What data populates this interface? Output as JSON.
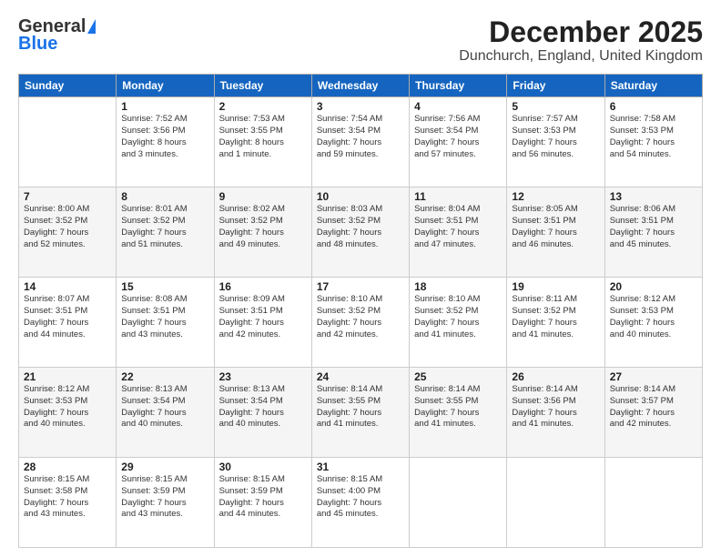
{
  "header": {
    "logo_general": "General",
    "logo_blue": "Blue",
    "month_title": "December 2025",
    "location": "Dunchurch, England, United Kingdom"
  },
  "days_of_week": [
    "Sunday",
    "Monday",
    "Tuesday",
    "Wednesday",
    "Thursday",
    "Friday",
    "Saturday"
  ],
  "weeks": [
    [
      {
        "day": "",
        "info": ""
      },
      {
        "day": "1",
        "info": "Sunrise: 7:52 AM\nSunset: 3:56 PM\nDaylight: 8 hours\nand 3 minutes."
      },
      {
        "day": "2",
        "info": "Sunrise: 7:53 AM\nSunset: 3:55 PM\nDaylight: 8 hours\nand 1 minute."
      },
      {
        "day": "3",
        "info": "Sunrise: 7:54 AM\nSunset: 3:54 PM\nDaylight: 7 hours\nand 59 minutes."
      },
      {
        "day": "4",
        "info": "Sunrise: 7:56 AM\nSunset: 3:54 PM\nDaylight: 7 hours\nand 57 minutes."
      },
      {
        "day": "5",
        "info": "Sunrise: 7:57 AM\nSunset: 3:53 PM\nDaylight: 7 hours\nand 56 minutes."
      },
      {
        "day": "6",
        "info": "Sunrise: 7:58 AM\nSunset: 3:53 PM\nDaylight: 7 hours\nand 54 minutes."
      }
    ],
    [
      {
        "day": "7",
        "info": "Sunrise: 8:00 AM\nSunset: 3:52 PM\nDaylight: 7 hours\nand 52 minutes."
      },
      {
        "day": "8",
        "info": "Sunrise: 8:01 AM\nSunset: 3:52 PM\nDaylight: 7 hours\nand 51 minutes."
      },
      {
        "day": "9",
        "info": "Sunrise: 8:02 AM\nSunset: 3:52 PM\nDaylight: 7 hours\nand 49 minutes."
      },
      {
        "day": "10",
        "info": "Sunrise: 8:03 AM\nSunset: 3:52 PM\nDaylight: 7 hours\nand 48 minutes."
      },
      {
        "day": "11",
        "info": "Sunrise: 8:04 AM\nSunset: 3:51 PM\nDaylight: 7 hours\nand 47 minutes."
      },
      {
        "day": "12",
        "info": "Sunrise: 8:05 AM\nSunset: 3:51 PM\nDaylight: 7 hours\nand 46 minutes."
      },
      {
        "day": "13",
        "info": "Sunrise: 8:06 AM\nSunset: 3:51 PM\nDaylight: 7 hours\nand 45 minutes."
      }
    ],
    [
      {
        "day": "14",
        "info": "Sunrise: 8:07 AM\nSunset: 3:51 PM\nDaylight: 7 hours\nand 44 minutes."
      },
      {
        "day": "15",
        "info": "Sunrise: 8:08 AM\nSunset: 3:51 PM\nDaylight: 7 hours\nand 43 minutes."
      },
      {
        "day": "16",
        "info": "Sunrise: 8:09 AM\nSunset: 3:51 PM\nDaylight: 7 hours\nand 42 minutes."
      },
      {
        "day": "17",
        "info": "Sunrise: 8:10 AM\nSunset: 3:52 PM\nDaylight: 7 hours\nand 42 minutes."
      },
      {
        "day": "18",
        "info": "Sunrise: 8:10 AM\nSunset: 3:52 PM\nDaylight: 7 hours\nand 41 minutes."
      },
      {
        "day": "19",
        "info": "Sunrise: 8:11 AM\nSunset: 3:52 PM\nDaylight: 7 hours\nand 41 minutes."
      },
      {
        "day": "20",
        "info": "Sunrise: 8:12 AM\nSunset: 3:53 PM\nDaylight: 7 hours\nand 40 minutes."
      }
    ],
    [
      {
        "day": "21",
        "info": "Sunrise: 8:12 AM\nSunset: 3:53 PM\nDaylight: 7 hours\nand 40 minutes."
      },
      {
        "day": "22",
        "info": "Sunrise: 8:13 AM\nSunset: 3:54 PM\nDaylight: 7 hours\nand 40 minutes."
      },
      {
        "day": "23",
        "info": "Sunrise: 8:13 AM\nSunset: 3:54 PM\nDaylight: 7 hours\nand 40 minutes."
      },
      {
        "day": "24",
        "info": "Sunrise: 8:14 AM\nSunset: 3:55 PM\nDaylight: 7 hours\nand 41 minutes."
      },
      {
        "day": "25",
        "info": "Sunrise: 8:14 AM\nSunset: 3:55 PM\nDaylight: 7 hours\nand 41 minutes."
      },
      {
        "day": "26",
        "info": "Sunrise: 8:14 AM\nSunset: 3:56 PM\nDaylight: 7 hours\nand 41 minutes."
      },
      {
        "day": "27",
        "info": "Sunrise: 8:14 AM\nSunset: 3:57 PM\nDaylight: 7 hours\nand 42 minutes."
      }
    ],
    [
      {
        "day": "28",
        "info": "Sunrise: 8:15 AM\nSunset: 3:58 PM\nDaylight: 7 hours\nand 43 minutes."
      },
      {
        "day": "29",
        "info": "Sunrise: 8:15 AM\nSunset: 3:59 PM\nDaylight: 7 hours\nand 43 minutes."
      },
      {
        "day": "30",
        "info": "Sunrise: 8:15 AM\nSunset: 3:59 PM\nDaylight: 7 hours\nand 44 minutes."
      },
      {
        "day": "31",
        "info": "Sunrise: 8:15 AM\nSunset: 4:00 PM\nDaylight: 7 hours\nand 45 minutes."
      },
      {
        "day": "",
        "info": ""
      },
      {
        "day": "",
        "info": ""
      },
      {
        "day": "",
        "info": ""
      }
    ]
  ]
}
